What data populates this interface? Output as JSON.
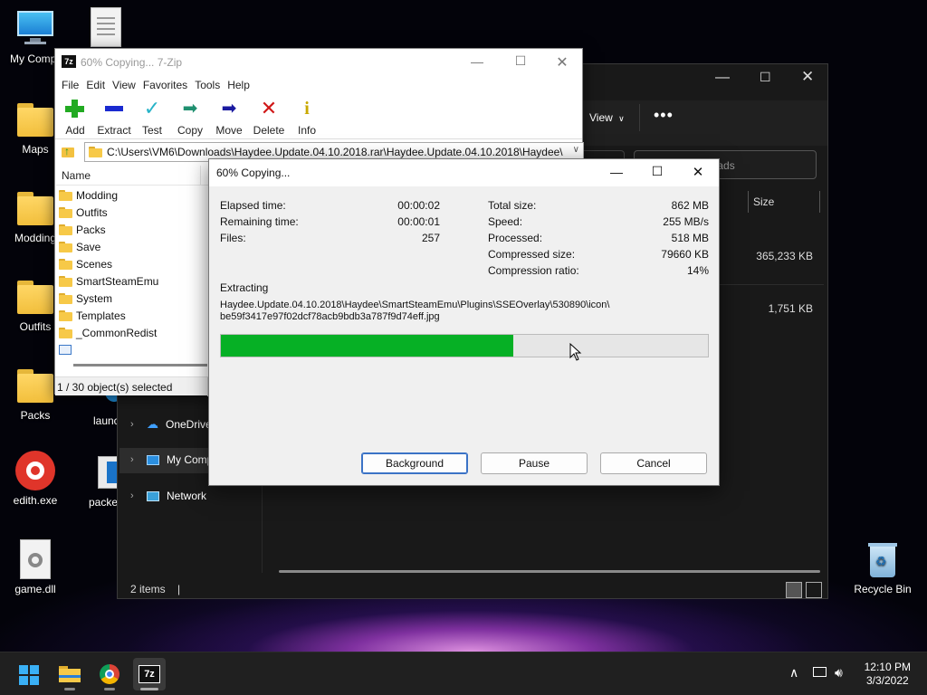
{
  "desktop": {
    "icons": [
      {
        "label": "My Computer"
      },
      {
        "label": "Maps"
      },
      {
        "label": "Modding"
      },
      {
        "label": "Outfits"
      },
      {
        "label": "Packs"
      },
      {
        "label": "launcher"
      },
      {
        "label": "edith.exe"
      },
      {
        "label": "packer.exe"
      },
      {
        "label": "game.dll"
      },
      {
        "label": "Recycle Bin"
      }
    ]
  },
  "explorer": {
    "view_label": "View",
    "more_label": "•••",
    "search_placeholder": "Search Downloads",
    "size_header": "Size",
    "rows": [
      {
        "size": "365,233 KB"
      },
      {
        "size": "1,751 KB"
      }
    ],
    "nav": [
      {
        "label": "OneDrive"
      },
      {
        "label": "My Computer"
      },
      {
        "label": "Network"
      }
    ],
    "status": "2 items",
    "status_sep": "|"
  },
  "sevenzip": {
    "title": "60% Copying... 7-Zip",
    "menu": [
      "File",
      "Edit",
      "View",
      "Favorites",
      "Tools",
      "Help"
    ],
    "toolbar": [
      {
        "label": "Add",
        "icon": "plus-icon",
        "color": "#22aa22"
      },
      {
        "label": "Extract",
        "icon": "minus-icon",
        "color": "#1a2ad0"
      },
      {
        "label": "Test",
        "icon": "check-icon",
        "color": "#27b3c8"
      },
      {
        "label": "Copy",
        "icon": "copy-arrow-icon",
        "color": "#209070"
      },
      {
        "label": "Move",
        "icon": "move-arrow-icon",
        "color": "#1a1aa0"
      },
      {
        "label": "Delete",
        "icon": "x-icon",
        "color": "#d01818"
      },
      {
        "label": "Info",
        "icon": "info-icon",
        "color": "#c8a800"
      }
    ],
    "path": "C:\\Users\\VM6\\Downloads\\Haydee.Update.04.10.2018.rar\\Haydee.Update.04.10.2018\\Haydee\\",
    "column_name": "Name",
    "items": [
      "Modding",
      "Outfits",
      "Packs",
      "Save",
      "Scenes",
      "SmartSteamEmu",
      "System",
      "Templates",
      "_CommonRedist"
    ],
    "status": "1 / 30 object(s) selected"
  },
  "dialog": {
    "title": "60% Copying...",
    "elapsed_label": "Elapsed time:",
    "elapsed_value": "00:00:02",
    "remaining_label": "Remaining time:",
    "remaining_value": "00:00:01",
    "files_label": "Files:",
    "files_value": "257",
    "total_label": "Total size:",
    "total_value": "862 MB",
    "speed_label": "Speed:",
    "speed_value": "255 MB/s",
    "processed_label": "Processed:",
    "processed_value": "518 MB",
    "compressed_label": "Compressed size:",
    "compressed_value": "79660 KB",
    "ratio_label": "Compression ratio:",
    "ratio_value": "14%",
    "operation": "Extracting",
    "file_line1": "Haydee.Update.04.10.2018\\Haydee\\SmartSteamEmu\\Plugins\\SSEOverlay\\530890\\icon\\",
    "file_line2": "be59f3417e97f02dcf78acb9bdb3a787f9d74eff.jpg",
    "progress": 0.6,
    "progress_color": "#06b025",
    "buttons": {
      "background": "Background",
      "pause": "Pause",
      "cancel": "Cancel"
    }
  },
  "taskbar": {
    "time": "12:10 PM",
    "date": "3/3/2022",
    "apps": [
      {
        "icon": "windows-start-icon"
      },
      {
        "icon": "file-explorer-icon"
      },
      {
        "icon": "chrome-icon"
      },
      {
        "icon": "sevenzip-icon",
        "label": "7z"
      }
    ]
  }
}
